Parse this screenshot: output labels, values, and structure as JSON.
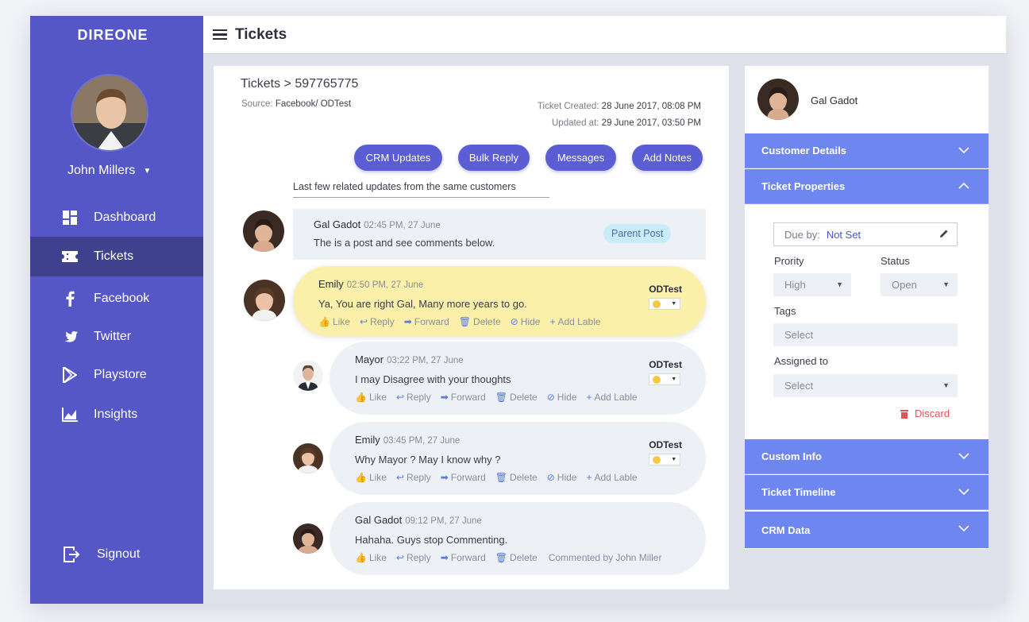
{
  "sidebar": {
    "brand": "DIREONE",
    "user_name": "John Millers",
    "items": [
      {
        "label": "Dashboard",
        "icon": "dashboard-icon"
      },
      {
        "label": "Tickets",
        "icon": "ticket-icon"
      },
      {
        "label": "Facebook",
        "icon": "facebook-icon"
      },
      {
        "label": "Twitter",
        "icon": "twitter-icon"
      },
      {
        "label": "Playstore",
        "icon": "playstore-icon"
      },
      {
        "label": "Insights",
        "icon": "insights-icon"
      }
    ],
    "signout": "Signout"
  },
  "header": {
    "title": "Tickets"
  },
  "ticket": {
    "title": "Tickets > 597765775",
    "source_label": "Source:",
    "source_value": "Facebook/ ODTest",
    "created_label": "Ticket Created:",
    "created_value": "28 June 2017, 08:08 PM",
    "updated_label": "Updated at:",
    "updated_value": "29 June 2017, 03:50 PM",
    "buttons": {
      "crm": "CRM Updates",
      "bulk": "Bulk Reply",
      "messages": "Messages",
      "notes": "Add Notes"
    },
    "related_text": "Last few related updates from the same customers"
  },
  "post": {
    "author": "Gal Gadot",
    "time": "02:45 PM, 27 June",
    "text": "The is a post and see comments below.",
    "badge": "Parent Post"
  },
  "actions": {
    "like": "Like",
    "reply": "Reply",
    "forward": "Forward",
    "delete": "Delete",
    "hide": "Hide",
    "add_label": "Add Lable"
  },
  "comments": [
    {
      "author": "Emily",
      "time": "02:50 PM, 27 June",
      "text": "Ya, You are right Gal, Many more years to go.",
      "tag": "ODTest"
    },
    {
      "author": "Mayor",
      "time": "03:22 PM, 27 June",
      "text": "I may Disagree with your thoughts",
      "tag": "ODTest"
    },
    {
      "author": "Emily",
      "time": "03:45 PM, 27 June",
      "text": "Why Mayor ? May I know why ?",
      "tag": "ODTest"
    },
    {
      "author": "Gal Gadot",
      "time": "09:12 PM, 27 June",
      "text": "Hahaha. Guys stop Commenting.",
      "commented_by": "Commented by John Miller"
    }
  ],
  "right": {
    "customer_name": "Gal Gadot",
    "sections": {
      "customer_details": "Customer Details",
      "ticket_properties": "Ticket  Properties",
      "custom_info": "Custom Info",
      "ticket_timeline": "Ticket Timeline",
      "crm_data": "CRM Data"
    },
    "due_label": "Due by:",
    "due_value": "Not Set",
    "priority_label": "Prority",
    "priority_value": "High",
    "status_label": "Status",
    "status_value": "Open",
    "tags_label": "Tags",
    "tags_placeholder": "Select",
    "assigned_label": "Assigned to",
    "assigned_value": "Select",
    "discard": "Discard"
  },
  "colors": {
    "sidebar": "#5557c6",
    "sidebar_active": "#3f418f",
    "accent": "#5b5dd4",
    "accordion": "#6e86ef",
    "highlight": "#fbf0a9",
    "danger": "#e05553"
  }
}
